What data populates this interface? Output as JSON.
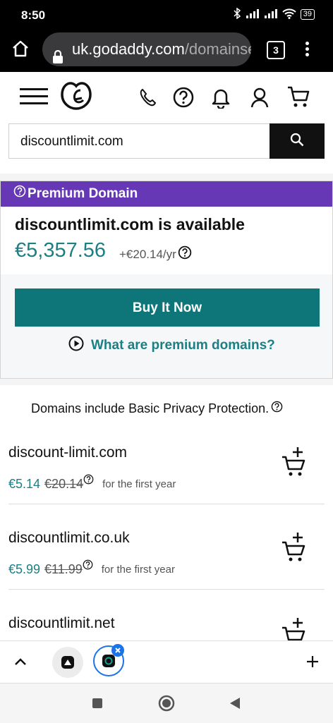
{
  "status_bar": {
    "time": "8:50",
    "battery": "39"
  },
  "browser": {
    "url_host": "uk.godaddy.com",
    "url_path": "/domainsea",
    "tab_count": "3"
  },
  "search": {
    "value": "discountlimit.com"
  },
  "premium": {
    "badge": "Premium Domain",
    "availability": "discountlimit.com is available",
    "price": "€5,357.56",
    "renewal": "+€20.14/yr",
    "buy_label": "Buy It Now",
    "learn_label": "What are premium domains?"
  },
  "results": {
    "privacy_note": "Domains include Basic Privacy Protection.",
    "items": [
      {
        "name": "discount-limit.com",
        "sale": "€5.14",
        "list": "€20.14",
        "note": "for the first year"
      },
      {
        "name": "discountlimit.co.uk",
        "sale": "€5.99",
        "list": "€11.99",
        "note": "for the first year"
      },
      {
        "name": "discountlimit.net",
        "sale": "",
        "list": "",
        "note": ""
      }
    ]
  },
  "colors": {
    "accent": "#1b7f84",
    "premium": "#6638b6",
    "button": "#0e7578"
  }
}
